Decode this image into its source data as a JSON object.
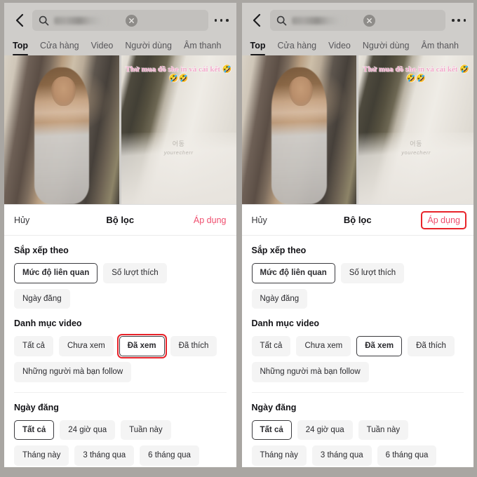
{
  "meta": {
    "accent_red": "#e8232a",
    "apply_pink": "#ef4e6e",
    "chip_bg": "#f4f4f4",
    "chrome_bg": "#cfcdca",
    "page_bg": "#a9a6a2"
  },
  "search": {
    "query_redacted": "",
    "placeholder": "",
    "back_icon": "chevron-left-icon",
    "search_icon": "search-icon",
    "clear_icon": "clear-circle-icon",
    "more_icon": "more-options-icon"
  },
  "tabs": [
    {
      "label": "Top",
      "active": true
    },
    {
      "label": "Cửa hàng",
      "active": false
    },
    {
      "label": "Video",
      "active": false
    },
    {
      "label": "Người dùng",
      "active": false
    },
    {
      "label": "Âm thanh",
      "active": false
    }
  ],
  "results": [
    {
      "overlay": "",
      "watermark": "",
      "watermark_sub": ""
    },
    {
      "overlay": "Thử mua đồ she in và cái kết 🤣🤣🤣",
      "watermark": "어동",
      "watermark_sub": "yourecherr"
    }
  ],
  "sheet": {
    "cancel_label": "Hủy",
    "title": "Bộ lọc",
    "apply_label": "Áp dụng",
    "sections": [
      {
        "key": "sort_by",
        "title": "Sắp xếp theo",
        "chips": [
          {
            "label": "Mức độ liên quan",
            "state": "selected"
          },
          {
            "label": "Số lượt thích",
            "state": "default"
          },
          {
            "label": "Ngày đăng",
            "state": "default"
          }
        ]
      },
      {
        "key": "video_category",
        "title": "Danh mục video",
        "chips": [
          {
            "label": "Tất cả",
            "state": "default"
          },
          {
            "label": "Chưa xem",
            "state": "default"
          },
          {
            "label": "Đã xem",
            "state": "selected"
          },
          {
            "label": "Đã thích",
            "state": "default"
          },
          {
            "label": "Những người mà bạn follow",
            "state": "default"
          }
        ]
      },
      {
        "key": "post_date",
        "title": "Ngày đăng",
        "chips": [
          {
            "label": "Tất cả",
            "state": "selected"
          },
          {
            "label": "24 giờ qua",
            "state": "default"
          },
          {
            "label": "Tuần này",
            "state": "default"
          },
          {
            "label": "Tháng này",
            "state": "default"
          },
          {
            "label": "3 tháng qua",
            "state": "default"
          },
          {
            "label": "6 tháng qua",
            "state": "default"
          }
        ]
      }
    ]
  },
  "panels": [
    {
      "key": "left",
      "annotation_target": "chip:video_category:Đã xem"
    },
    {
      "key": "right",
      "annotation_target": "button:apply"
    }
  ]
}
